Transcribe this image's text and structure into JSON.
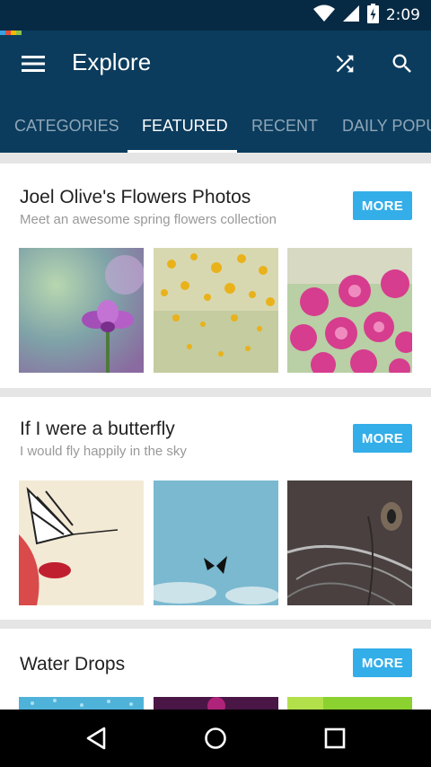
{
  "status_bar": {
    "time": "2:09",
    "battery_icon": "battery-charging-icon",
    "signal_icon": "cell-signal-icon",
    "wifi_icon": "wifi-icon"
  },
  "colors": {
    "status_bar_bg": "#072a44",
    "app_bar_bg": "#0b3c5d",
    "accent": "#33aee8",
    "tab_inactive": "#8fa6b8",
    "page_bg": "#e5e5e5"
  },
  "app_bar": {
    "title": "Explore",
    "menu_icon": "hamburger-menu-icon",
    "shuffle_icon": "shuffle-icon",
    "search_icon": "search-icon"
  },
  "tabs": [
    {
      "label": "CATEGORIES",
      "active": false
    },
    {
      "label": "FEATURED",
      "active": true
    },
    {
      "label": "RECENT",
      "active": false
    },
    {
      "label": "DAILY POPU",
      "active": false
    }
  ],
  "collections": [
    {
      "title": "Joel Olive's Flowers Photos",
      "subtitle": "Meet an awesome spring flowers collection",
      "more_label": "MORE",
      "photos": [
        "purple-flower-photo",
        "yellow-flowers-photo",
        "pink-flowers-photo"
      ]
    },
    {
      "title": "If I were a butterfly",
      "subtitle": "I would fly happily in the sky",
      "more_label": "MORE",
      "photos": [
        "butterfly-lips-photo",
        "butterfly-sky-photo",
        "butterfly-grass-photo"
      ]
    },
    {
      "title": "Water Drops",
      "subtitle": "",
      "more_label": "MORE",
      "photos": [
        "water-drops-blue-photo",
        "water-drops-purple-photo",
        "water-drops-green-photo"
      ]
    }
  ],
  "nav_bar": {
    "back_icon": "back-icon",
    "home_icon": "home-icon",
    "recents_icon": "recents-icon"
  }
}
